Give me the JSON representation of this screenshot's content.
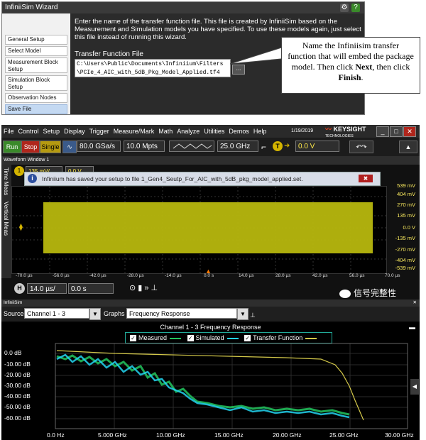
{
  "wizard": {
    "title": "InfiniiSim Wizard",
    "steps": [
      "General Setup",
      "Select Model",
      "Measurement Block Setup",
      "Simulation Block Setup",
      "Observation Nodes",
      "Save File"
    ],
    "active_step": "Save File",
    "description": "Enter the name of the transfer function file. This file is created by InfiniiSim based on the Measurement and Simulation models you have specified. To use these models again, just select this file instead of running this wizard.",
    "tf_label": "Transfer Function File",
    "tf_path_line1": "C:\\Users\\Public\\Documents\\Infiniium\\Filters",
    "tf_path_line2": "\\PCIe_4_AIC_with_5dB_Pkg_Model_Applied.tf4",
    "browse_label": "...",
    "settings_icon": "gear-icon",
    "help_label": "?"
  },
  "callout": {
    "text_before": "Name the Infiniisim transfer function that will embed the package model.  Then click ",
    "next": "Next",
    "text_middle": ", then click ",
    "finish": "Finish",
    "text_after": "."
  },
  "scope": {
    "menu": [
      "File",
      "Control",
      "Setup",
      "Display",
      "Trigger",
      "Measure/Mark",
      "Math",
      "Analyze",
      "Utilities",
      "Demos",
      "Help"
    ],
    "date": "1/19/2019",
    "brand": "KEYSIGHT",
    "brand_sub": "TECHNOLOGIES",
    "run_label": "Run",
    "stop_label": "Stop",
    "single_label": "Single",
    "sample_rate": "80.0 GSa/s",
    "memory_depth": "10.0 Mpts",
    "bandwidth": "25.0 GHz",
    "trigger_level": "0.0 V",
    "waveform_window_title": "Waveform Window 1",
    "side_tabs": [
      "Time Meas",
      "Vertical Meas"
    ],
    "notification": "Infiniium has saved your setup to file 1_Gen4_Seutp_For_AIC_with_5dB_pkg_model_applied.set.",
    "notification_close": "✖",
    "channel_scale": "135 mV/",
    "channel_offset": "0.0 V",
    "y_labels": [
      "539 mV",
      "404 mV",
      "270 mV",
      "135 mV",
      "0.0 V",
      "-135 mV",
      "-270 mV",
      "-404 mV",
      "-539 mV"
    ],
    "x_labels": [
      "-70.0 µs",
      "-56.0 µs",
      "-42.0 µs",
      "-28.0 µs",
      "-14.0 µs",
      "0.0 s",
      "14.0 µs",
      "28.0 µs",
      "42.0 µs",
      "56.0 µs",
      "70.0 µs"
    ],
    "timebase_scale": "14.0 µs/",
    "timebase_delay": "0.0 s",
    "colors": {
      "waveform": "#b7b70e",
      "measured": "#22c55e",
      "simulated": "#22d3ee",
      "transfer_function": "#d4c94a"
    }
  },
  "infiniisim": {
    "panel_title": "InfiniiSim",
    "source_label": "Source",
    "source_value": "Channel 1 - 3",
    "graphs_label": "Graphs",
    "graphs_value": "Frequency Response",
    "plot_title": "Channel 1 - 3 Frequency Response",
    "legend": [
      "Measured",
      "Simulated",
      "Transfer Function"
    ],
    "y_labels": [
      "0.0 dB",
      "-10.00 dB",
      "-20.00 dB",
      "-30.00 dB",
      "-40.00 dB",
      "-50.00 dB",
      "-60.00 dB"
    ],
    "x_labels": [
      "0.0 Hz",
      "5.000 GHz",
      "10.00 GHz",
      "15.00 GHz",
      "20.00 GHz",
      "25.00 GHz",
      "30.00 GHz"
    ]
  },
  "watermark": "信号完整性"
}
